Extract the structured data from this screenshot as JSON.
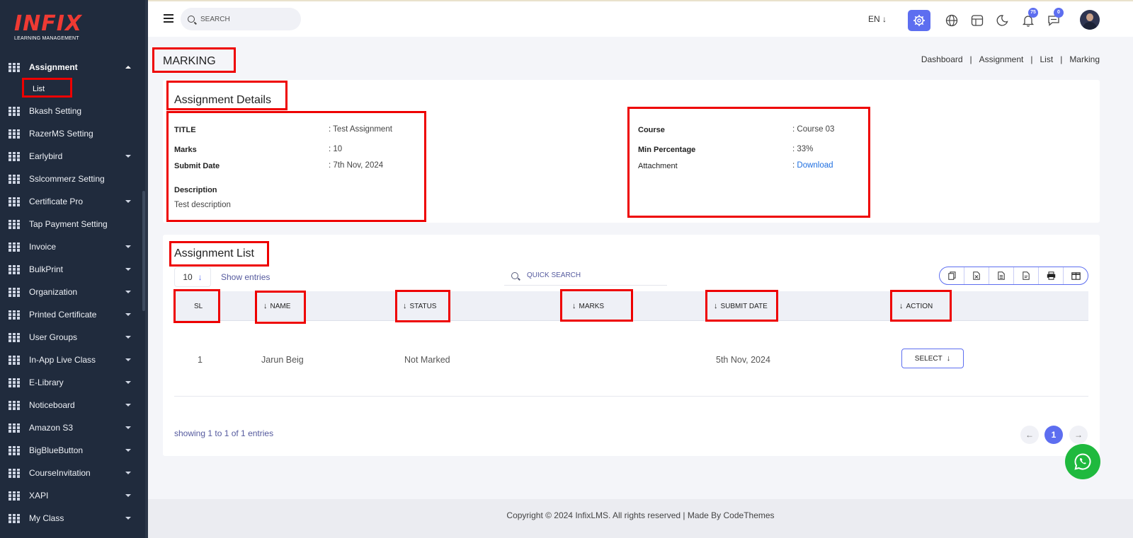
{
  "brand": {
    "logo_text": "INFIX",
    "logo_sub": "LEARNING MANAGEMENT"
  },
  "sidebar": {
    "items": [
      {
        "label": "Assignment",
        "active": true,
        "caret": "up",
        "sub": [
          {
            "label": "List"
          }
        ]
      },
      {
        "label": "Bkash Setting",
        "caret": ""
      },
      {
        "label": "RazerMS Setting",
        "caret": ""
      },
      {
        "label": "Earlybird",
        "caret": "down"
      },
      {
        "label": "Sslcommerz Setting",
        "caret": ""
      },
      {
        "label": "Certificate Pro",
        "caret": "down"
      },
      {
        "label": "Tap Payment Setting",
        "caret": ""
      },
      {
        "label": "Invoice",
        "caret": "down"
      },
      {
        "label": "BulkPrint",
        "caret": "down"
      },
      {
        "label": "Organization",
        "caret": "down"
      },
      {
        "label": "Printed Certificate",
        "caret": "down"
      },
      {
        "label": "User Groups",
        "caret": "down"
      },
      {
        "label": "In-App Live Class",
        "caret": "down"
      },
      {
        "label": "E-Library",
        "caret": "down"
      },
      {
        "label": "Noticeboard",
        "caret": "down"
      },
      {
        "label": "Amazon S3",
        "caret": "down"
      },
      {
        "label": "BigBlueButton",
        "caret": "down"
      },
      {
        "label": "CourseInvitation",
        "caret": "down"
      },
      {
        "label": "XAPI",
        "caret": "down"
      },
      {
        "label": "My Class",
        "caret": "down"
      }
    ]
  },
  "topbar": {
    "search_placeholder": "SEARCH",
    "language": "EN",
    "notifications_count": "75",
    "messages_count": "0",
    "accent_color": "#5d6ef0"
  },
  "page": {
    "title": "MARKING",
    "breadcrumb": [
      "Dashboard",
      "Assignment",
      "List",
      "Marking"
    ]
  },
  "details": {
    "heading": "Assignment Details",
    "title_label": "TITLE",
    "title_value": ": Test Assignment",
    "marks_label": "Marks",
    "marks_value": ": 10",
    "submit_label": "Submit Date",
    "submit_value": ": 7th Nov, 2024",
    "description_label": "Description",
    "description_value": "Test description",
    "course_label": "Course",
    "course_value": ": Course 03",
    "min_label": "Min Percentage",
    "min_value": ": 33%",
    "attachment_label": "Attachment",
    "attachment_prefix": ": ",
    "attachment_link": "Download"
  },
  "list": {
    "heading": "Assignment List",
    "page_size": "10",
    "show_entries": "Show entries",
    "quick_search_placeholder": "QUICK SEARCH",
    "export_icons": [
      "copy-icon",
      "csv-icon",
      "excel-icon",
      "pdf-icon",
      "print-icon",
      "columns-icon"
    ],
    "columns": [
      "SL",
      "NAME",
      "STATUS",
      "MARKS",
      "SUBMIT DATE",
      "ACTION"
    ],
    "rows": [
      {
        "sl": "1",
        "name": "Jarun Beig",
        "status": "Not Marked",
        "marks": "",
        "submit_date": "5th Nov, 2024",
        "action": "SELECT"
      }
    ],
    "showing": "showing 1 to 1 of 1 entries",
    "current_page": "1"
  },
  "footer": {
    "text": "Copyright © 2024 InfixLMS. All rights reserved | Made By CodeThemes"
  }
}
